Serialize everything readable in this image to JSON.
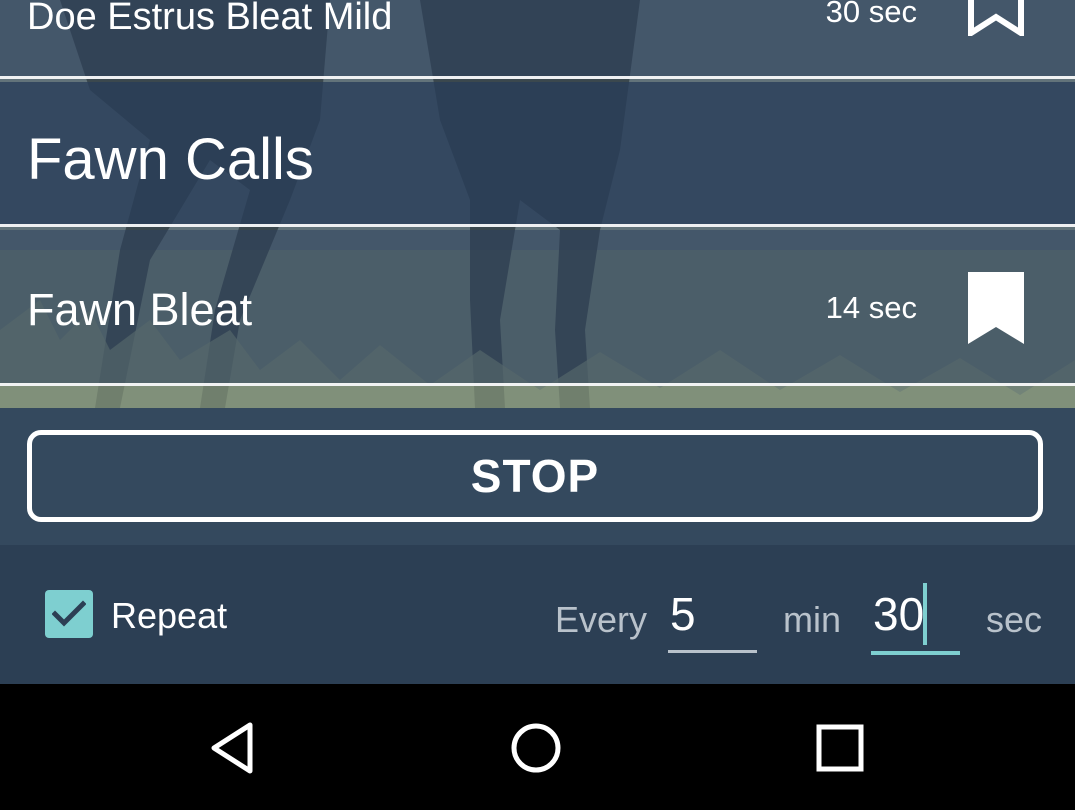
{
  "list": {
    "items": [
      {
        "type": "sound",
        "title": "Doe Estrus Bleat Mild",
        "duration": "30 sec",
        "bookmark_icon": "bookmark-outline-icon"
      },
      {
        "type": "category",
        "title": "Fawn Calls"
      },
      {
        "type": "sound",
        "title": "Fawn Bleat",
        "duration": "14 sec",
        "bookmark_icon": "bookmark-filled-icon"
      }
    ]
  },
  "controls": {
    "stop_label": "STOP",
    "repeat_label": "Repeat",
    "repeat_checked": true,
    "every_label": "Every",
    "minutes_value": "5",
    "min_label": "min",
    "seconds_value": "30",
    "sec_label": "sec"
  },
  "navbar": {
    "back_icon": "back-triangle-icon",
    "home_icon": "home-circle-icon",
    "recents_icon": "recents-square-icon"
  },
  "colors": {
    "accent": "#7ecfd0",
    "control_bg": "#34495e",
    "repeat_bg": "#2c3f54",
    "nav_bg": "#000000"
  }
}
